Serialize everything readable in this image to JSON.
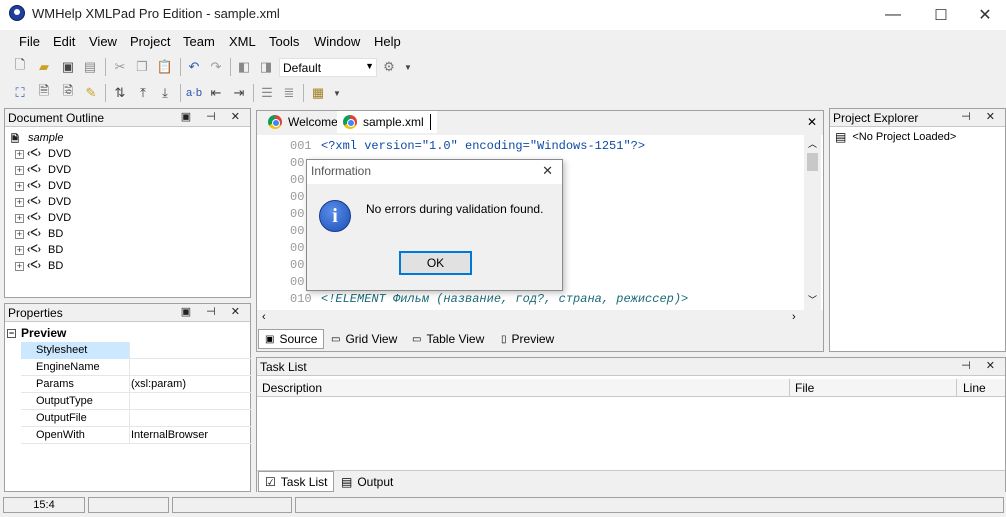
{
  "window": {
    "title": "WMHelp XMLPad Pro Edition - sample.xml",
    "minimize": "—",
    "maximize": "☐",
    "close": "✕"
  },
  "menu": [
    "File",
    "Edit",
    "View",
    "Project",
    "Team",
    "XML",
    "Tools",
    "Window",
    "Help"
  ],
  "toolbar": {
    "profile_combo": "Default"
  },
  "outline": {
    "title": "Document Outline",
    "controls": "▣ ⊣ ✕",
    "root": "sample",
    "nodes": [
      "DVD",
      "DVD",
      "DVD",
      "DVD",
      "DVD",
      "BD",
      "BD",
      "BD"
    ]
  },
  "properties": {
    "title": "Properties",
    "controls": "▣ ⊣ ✕",
    "group": "Preview",
    "rows": [
      {
        "key": "Stylesheet",
        "value": ""
      },
      {
        "key": "EngineName",
        "value": ""
      },
      {
        "key": "Params",
        "value": "(xsl:param)"
      },
      {
        "key": "OutputType",
        "value": ""
      },
      {
        "key": "OutputFile",
        "value": ""
      },
      {
        "key": "OpenWith",
        "value": "InternalBrowser"
      }
    ]
  },
  "editor": {
    "tabs": [
      "Welcome",
      "sample.xml"
    ],
    "line_numbers": [
      "001",
      "00",
      "00",
      "00",
      "00",
      "00",
      "00",
      "00",
      "00",
      "010"
    ],
    "line1": "<?xml version=\"1.0\" encoding=\"Windows-1251\"?>",
    "line10": "<!ELEMENT Фильм (название, год?, страна, режиссер)>",
    "bottom_tabs": [
      "Source",
      "Grid View",
      "Table View",
      "Preview"
    ]
  },
  "project": {
    "title": "Project Explorer",
    "controls": "⊣ ✕",
    "item": "<No Project Loaded>"
  },
  "tasks": {
    "title": "Task List",
    "controls": "⊣ ✕",
    "columns": [
      "Description",
      "File",
      "Line"
    ],
    "tabs": [
      "Task List",
      "Output"
    ]
  },
  "dialog": {
    "title": "Information",
    "message": "No errors during validation found.",
    "ok": "OK",
    "close": "✕",
    "icon": "i"
  },
  "status": {
    "position": "15:4"
  },
  "colors": {
    "selection": "#cce8ff",
    "code_blue": "#0f4aa6",
    "accent": "#0078d7"
  }
}
